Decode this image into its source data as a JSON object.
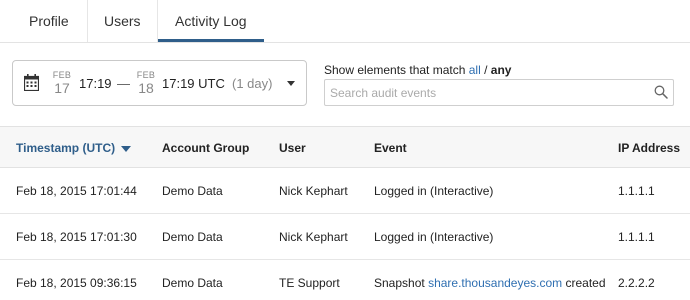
{
  "tabs": [
    {
      "label": "Profile"
    },
    {
      "label": "Users"
    },
    {
      "label": "Activity Log"
    }
  ],
  "date_range": {
    "start": {
      "month": "FEB",
      "day": "17",
      "time": "17:19"
    },
    "separator": "—",
    "end": {
      "month": "FEB",
      "day": "18",
      "time": "17:19 UTC"
    },
    "duration": "(1 day)"
  },
  "search": {
    "match_prefix": "Show elements that match",
    "match_all": "all",
    "match_sep": "/",
    "match_any": "any",
    "placeholder": "Search audit events"
  },
  "table": {
    "columns": [
      "Timestamp (UTC)",
      "Account Group",
      "User",
      "Event",
      "IP Address"
    ],
    "rows": [
      {
        "timestamp": "Feb 18, 2015 17:01:44",
        "group": "Demo Data",
        "user": "Nick Kephart",
        "event_pre": "Logged in (Interactive)",
        "event_link": "",
        "event_post": "",
        "ip": "1.1.1.1"
      },
      {
        "timestamp": "Feb 18, 2015 17:01:30",
        "group": "Demo Data",
        "user": "Nick Kephart",
        "event_pre": "Logged in (Interactive)",
        "event_link": "",
        "event_post": "",
        "ip": "1.1.1.1"
      },
      {
        "timestamp": "Feb 18, 2015 09:36:15",
        "group": "Demo Data",
        "user": "TE Support",
        "event_pre": "Snapshot",
        "event_link": "share.thousandeyes.com",
        "event_post": "created",
        "ip": "2.2.2.2"
      }
    ]
  },
  "colors": {
    "accent": "#2f5e8a",
    "link": "#2f6fb1"
  }
}
